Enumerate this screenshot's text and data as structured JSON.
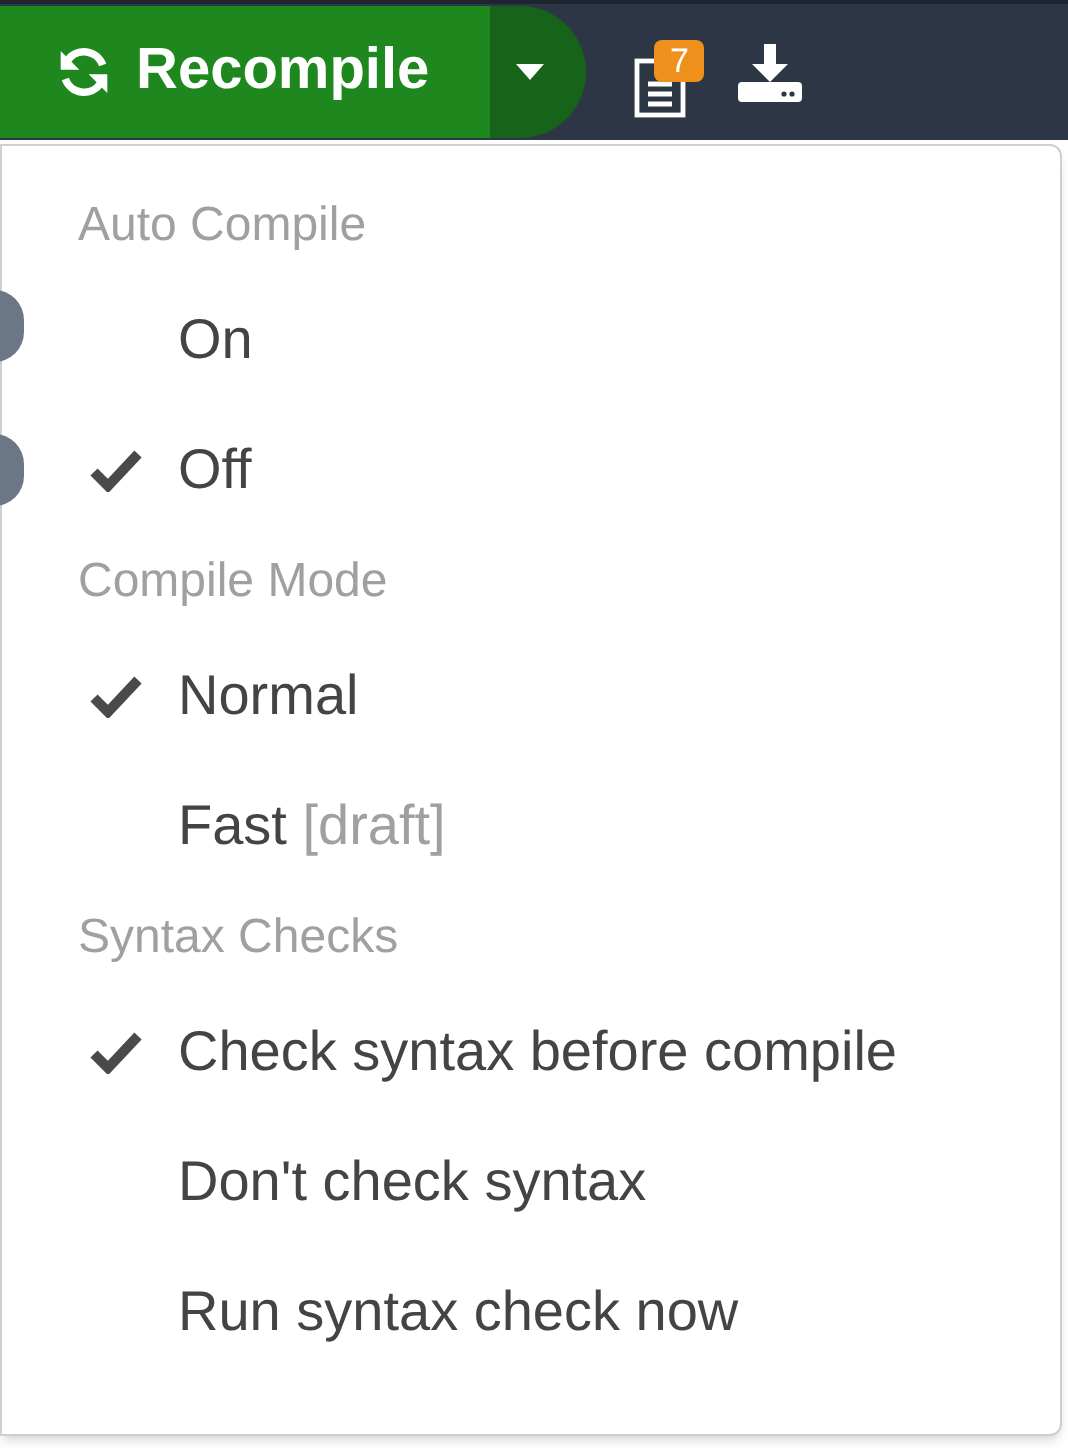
{
  "toolbar": {
    "recompile_label": "Recompile",
    "logs_badge": "7"
  },
  "menu": {
    "sections": [
      {
        "title": "Auto Compile",
        "items": [
          {
            "label": "On",
            "checked": false
          },
          {
            "label": "Off",
            "checked": true
          }
        ]
      },
      {
        "title": "Compile Mode",
        "items": [
          {
            "label": "Normal",
            "checked": true
          },
          {
            "label": "Fast",
            "hint": "[draft]",
            "checked": false
          }
        ]
      },
      {
        "title": "Syntax Checks",
        "items": [
          {
            "label": "Check syntax before compile",
            "checked": true
          },
          {
            "label": "Don't check syntax",
            "checked": false
          },
          {
            "label": "Run syntax check now",
            "checked": false
          }
        ]
      }
    ]
  }
}
